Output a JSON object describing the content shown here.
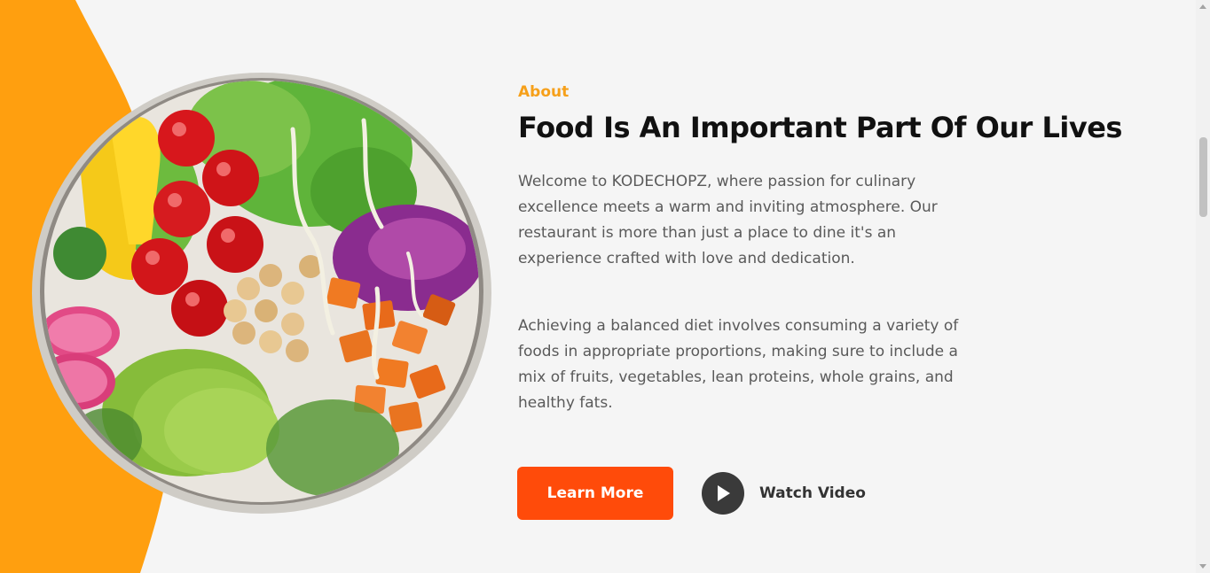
{
  "about": {
    "eyebrow": "About",
    "title": "Food Is An Important Part Of Our Lives",
    "paragraph_1": "Welcome to KODECHOPZ, where passion for culinary excellence meets a warm and inviting atmosphere. Our restaurant is more than just a place to dine it's an experience crafted with love and dedication.",
    "paragraph_2": "Achieving a balanced diet involves consuming a variety of foods in appropriate proportions, making sure to include a mix of fruits, vegetables, lean proteins, whole grains, and healthy fats."
  },
  "actions": {
    "learn_more_label": "Learn More",
    "watch_video_label": "Watch Video"
  },
  "icons": {
    "play": "play-icon"
  },
  "colors": {
    "accent_orange": "#ff9f0f",
    "eyebrow": "#f6a01a",
    "button": "#ff4b0a",
    "play_circle": "#3a3a3a",
    "background": "#f5f5f5"
  }
}
